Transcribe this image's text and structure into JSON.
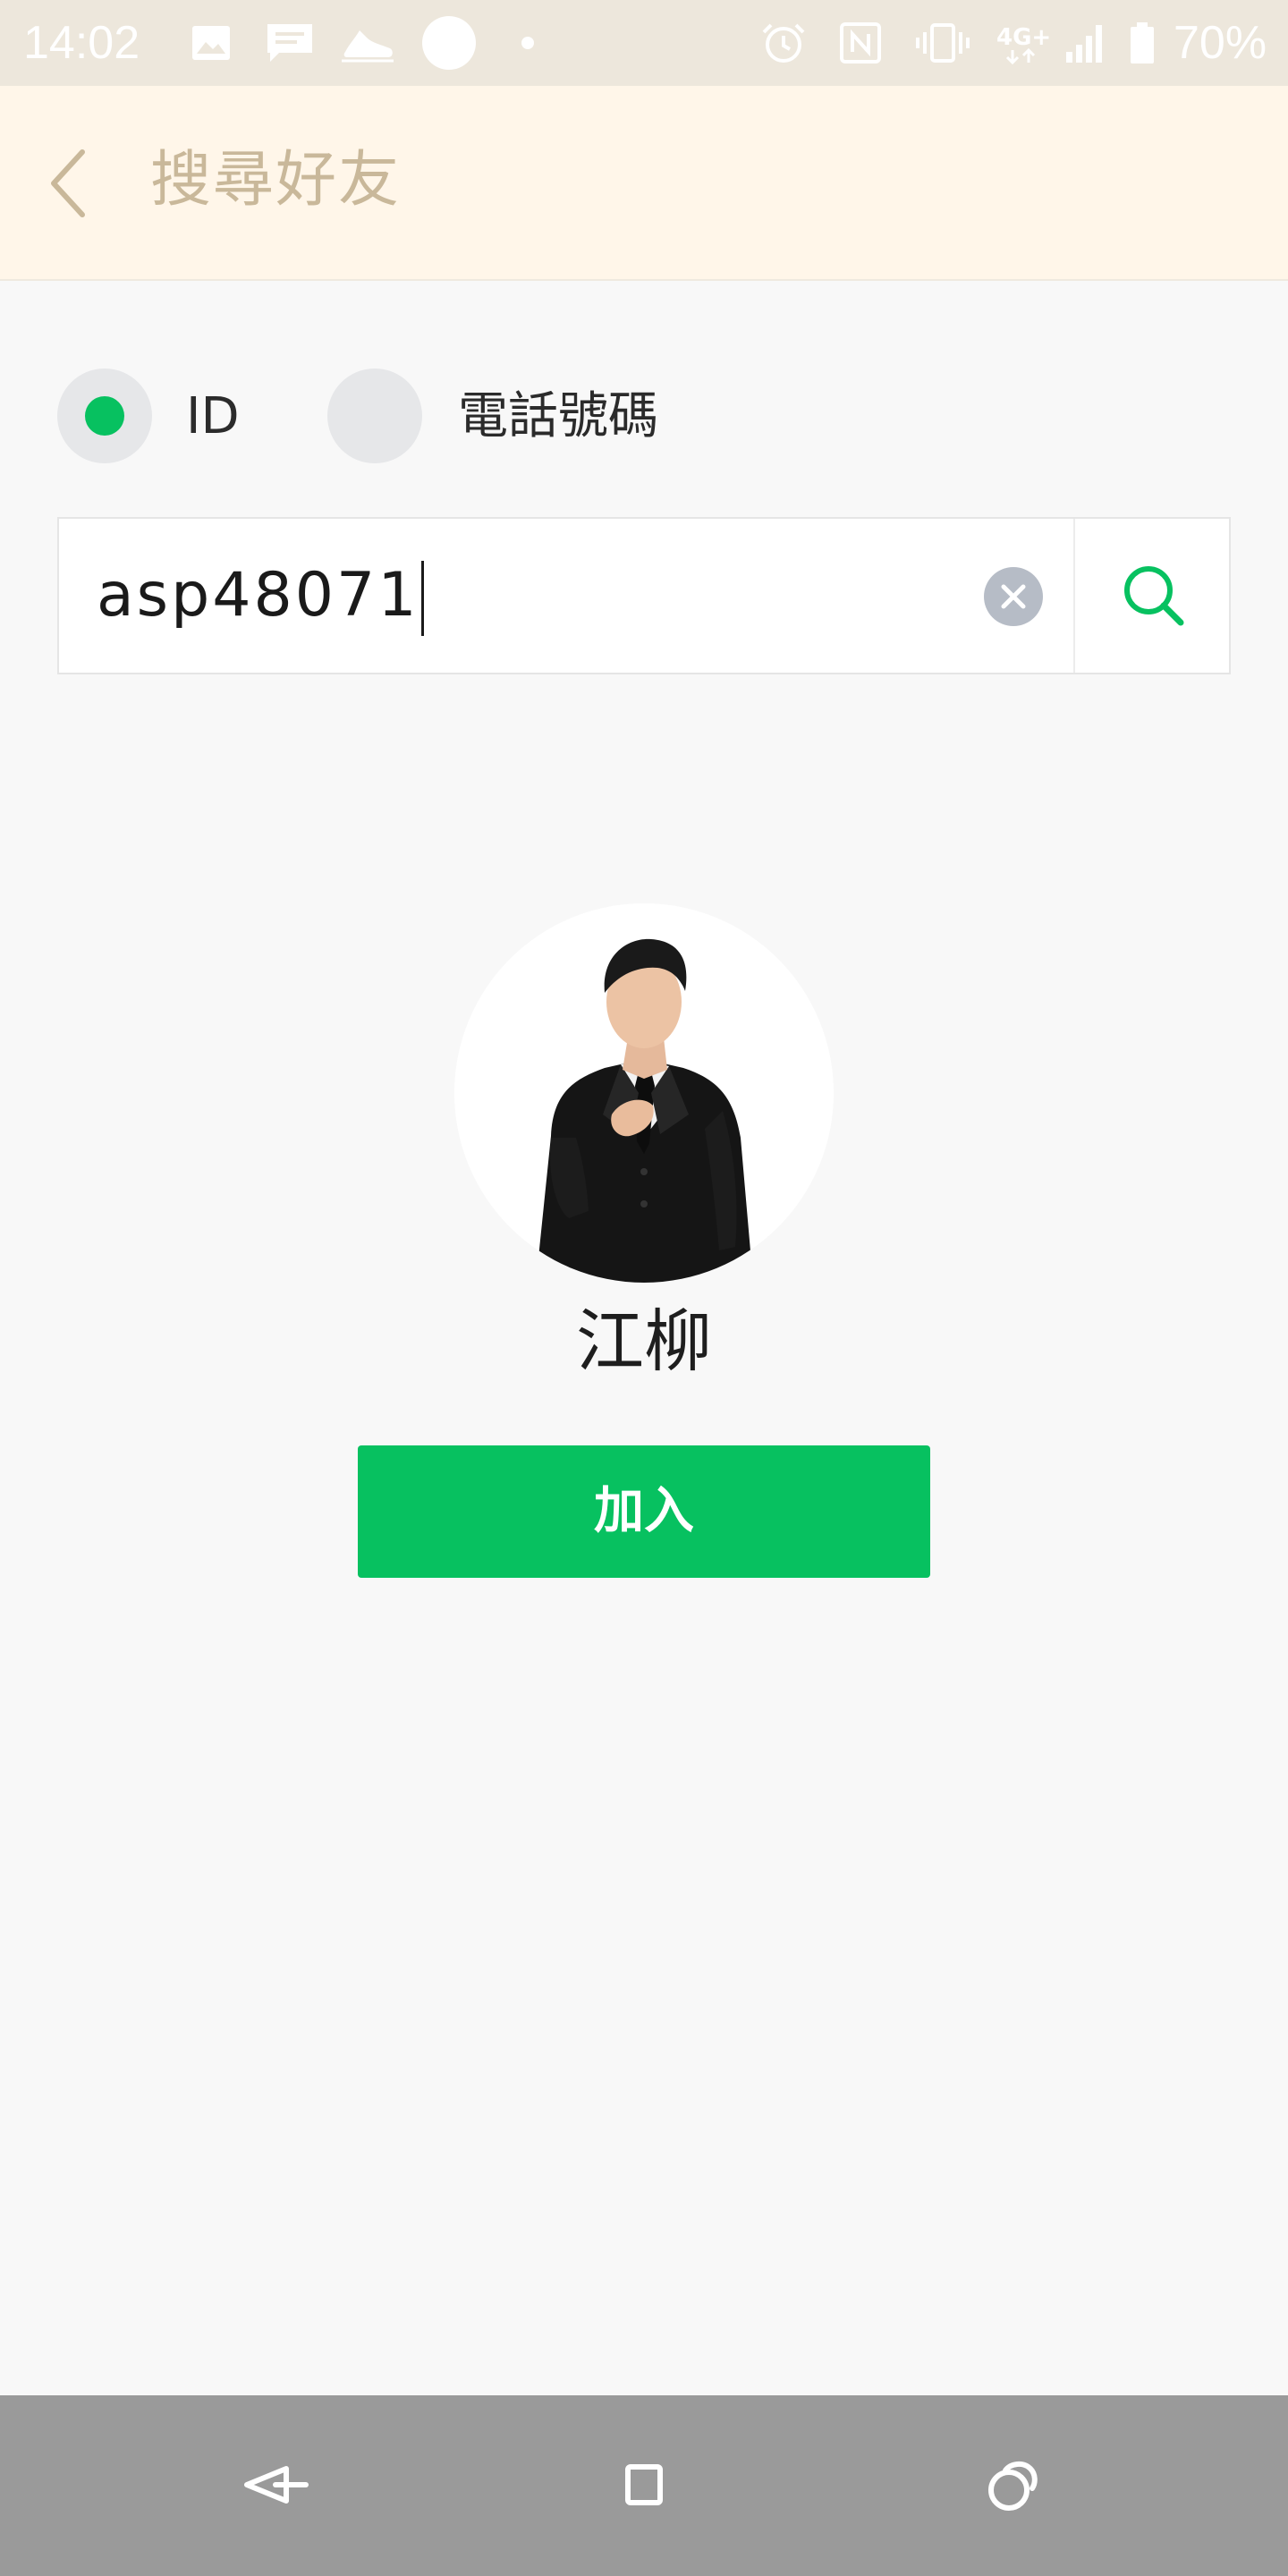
{
  "status_bar": {
    "time": "14:02",
    "battery": "70%",
    "icons": [
      "image-icon",
      "message-icon",
      "shoe-icon",
      "circle-icon",
      "dot-icon",
      "alarm-icon",
      "nfc-icon",
      "vibrate-icon",
      "4g-icon",
      "signal-icon",
      "battery-icon"
    ]
  },
  "header": {
    "title": "搜尋好友",
    "back_icon": "chevron-left-icon",
    "color": "#c9b89a"
  },
  "search_type": {
    "options": [
      {
        "label": "ID",
        "selected": true
      },
      {
        "label": "電話號碼",
        "selected": false
      }
    ],
    "selected_color": "#07c160"
  },
  "search": {
    "value": "asp48071",
    "clear_icon": "clear-icon",
    "search_icon": "search-icon"
  },
  "result": {
    "name": "江柳",
    "add_label": "加入",
    "accent": "#07c160"
  },
  "nav_bar": {
    "buttons": [
      "back-nav-icon",
      "home-nav-icon",
      "recents-nav-icon"
    ]
  }
}
